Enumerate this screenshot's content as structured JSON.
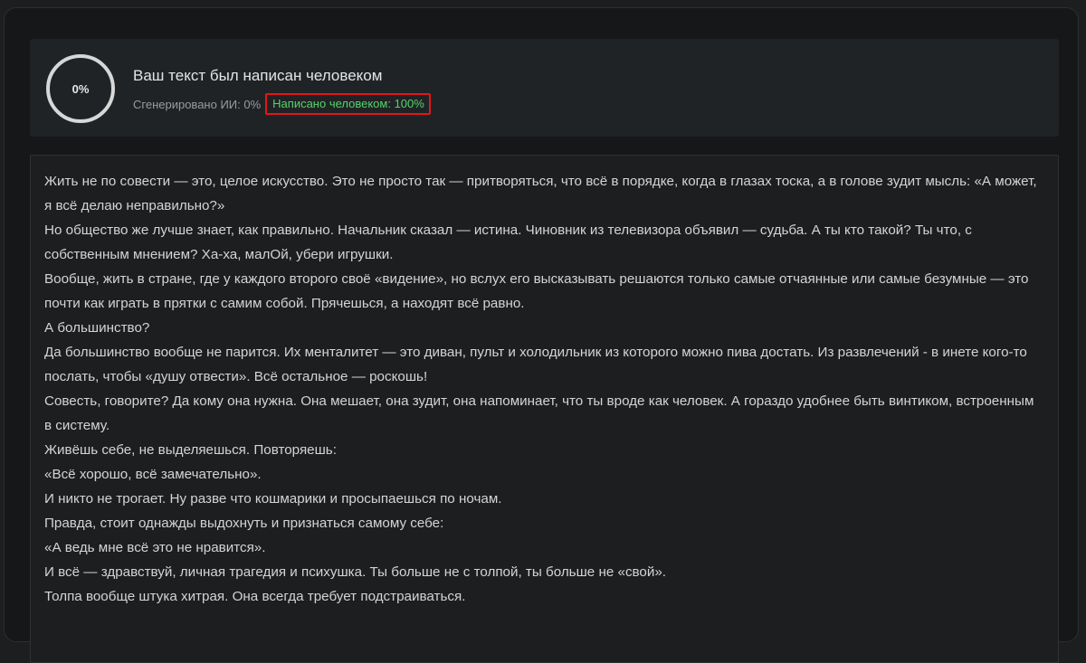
{
  "summary": {
    "score_label": "0%",
    "title": "Ваш текст был написан человеком",
    "ai_generated": "Сгенерировано ИИ: 0%",
    "human_written": "Написано человеком: 100%",
    "ai_share": 0,
    "colors": {
      "human_accent": "#54d36a",
      "highlight_box": "#e01818"
    }
  },
  "analyzed_text": {
    "paragraphs": [
      "Жить не по совести — это, целое искусство. Это не просто так — притворяться, что всё в порядке, когда в глазах тоска, а в голове зудит мысль: «А может, я всё делаю неправильно?»",
      "Но общество же лучше знает, как правильно. Начальник сказал — истина. Чиновник из телевизора объявил — судьба. А ты кто такой? Ты что, с собственным мнением? Ха-ха, малОй, убери игрушки.",
      "Вообще, жить в стране, где у каждого второго своё «видение», но вслух его высказывать решаются только самые отчаянные или самые безумные — это почти как играть в прятки с самим собой. Прячешься, а находят всё равно.",
      "А большинство?",
      "Да большинство вообще не парится. Их менталитет — это диван, пульт и холодильник из которого можно пива достать. Из развлечений - в инете кого-то послать, чтобы «душу отвести». Всё остальное — роскошь!",
      "Совесть, говорите? Да кому она нужна. Она мешает, она зудит, она напоминает, что ты вроде как человек. А гораздо удобнее быть винтиком, встроенным в систему.",
      "Живёшь себе, не выделяешься. Повторяешь:",
      "«Всё хорошо, всё замечательно».",
      "И никто не трогает. Ну разве что кошмарики и просыпаешься по ночам.",
      "Правда, стоит однажды выдохнуть и признаться самому себе:",
      "«А ведь мне всё это не нравится».",
      "И всё — здравствуй, личная трагедия и психушка. Ты больше не с толпой, ты больше не «свой».",
      "Толпа вообще штука хитрая. Она всегда требует подстраиваться."
    ]
  }
}
